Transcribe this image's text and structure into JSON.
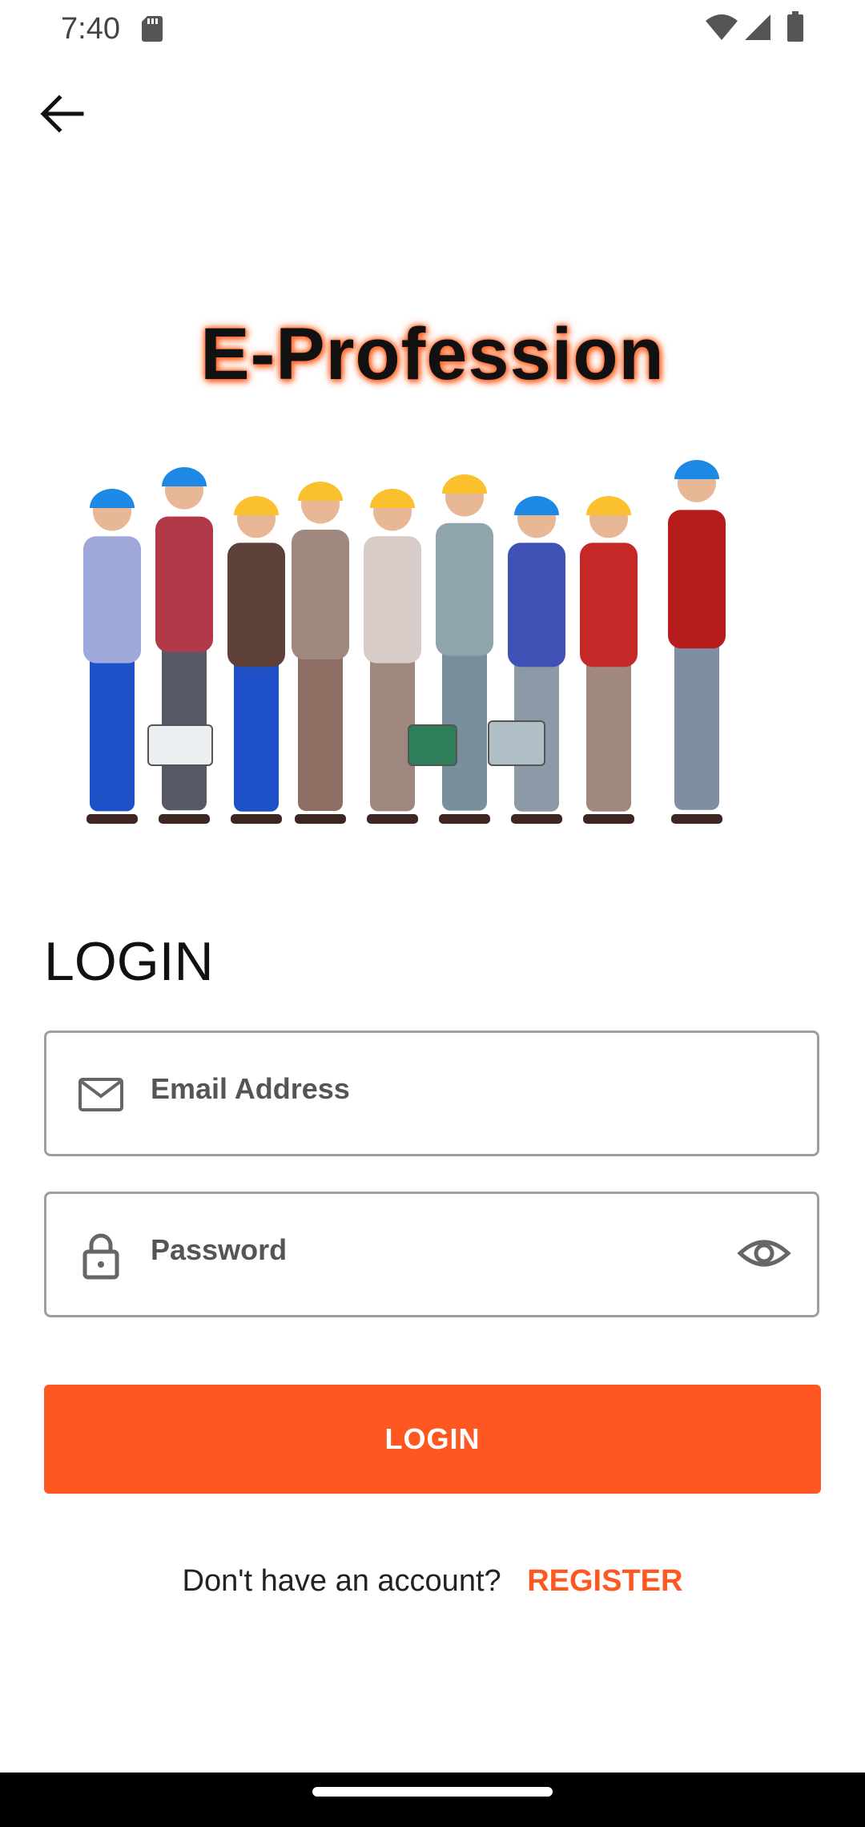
{
  "status_bar": {
    "time": "7:40",
    "icons": [
      "sd-card-icon",
      "wifi-icon",
      "signal-icon",
      "battery-icon"
    ]
  },
  "header": {
    "back_icon": "back-arrow-icon"
  },
  "hero": {
    "title": "E-Profession",
    "title_glow_color": "#ff5a1f"
  },
  "login": {
    "heading": "LOGIN",
    "email": {
      "placeholder": "Email Address",
      "value": "",
      "icon": "mail-icon"
    },
    "password": {
      "placeholder": "Password",
      "value": "",
      "icon": "lock-icon",
      "toggle_icon": "eye-icon"
    },
    "button_label": "LOGIN",
    "accent_color": "#ff5722"
  },
  "register": {
    "prompt": "Don't have an account?",
    "link_label": "REGISTER"
  }
}
